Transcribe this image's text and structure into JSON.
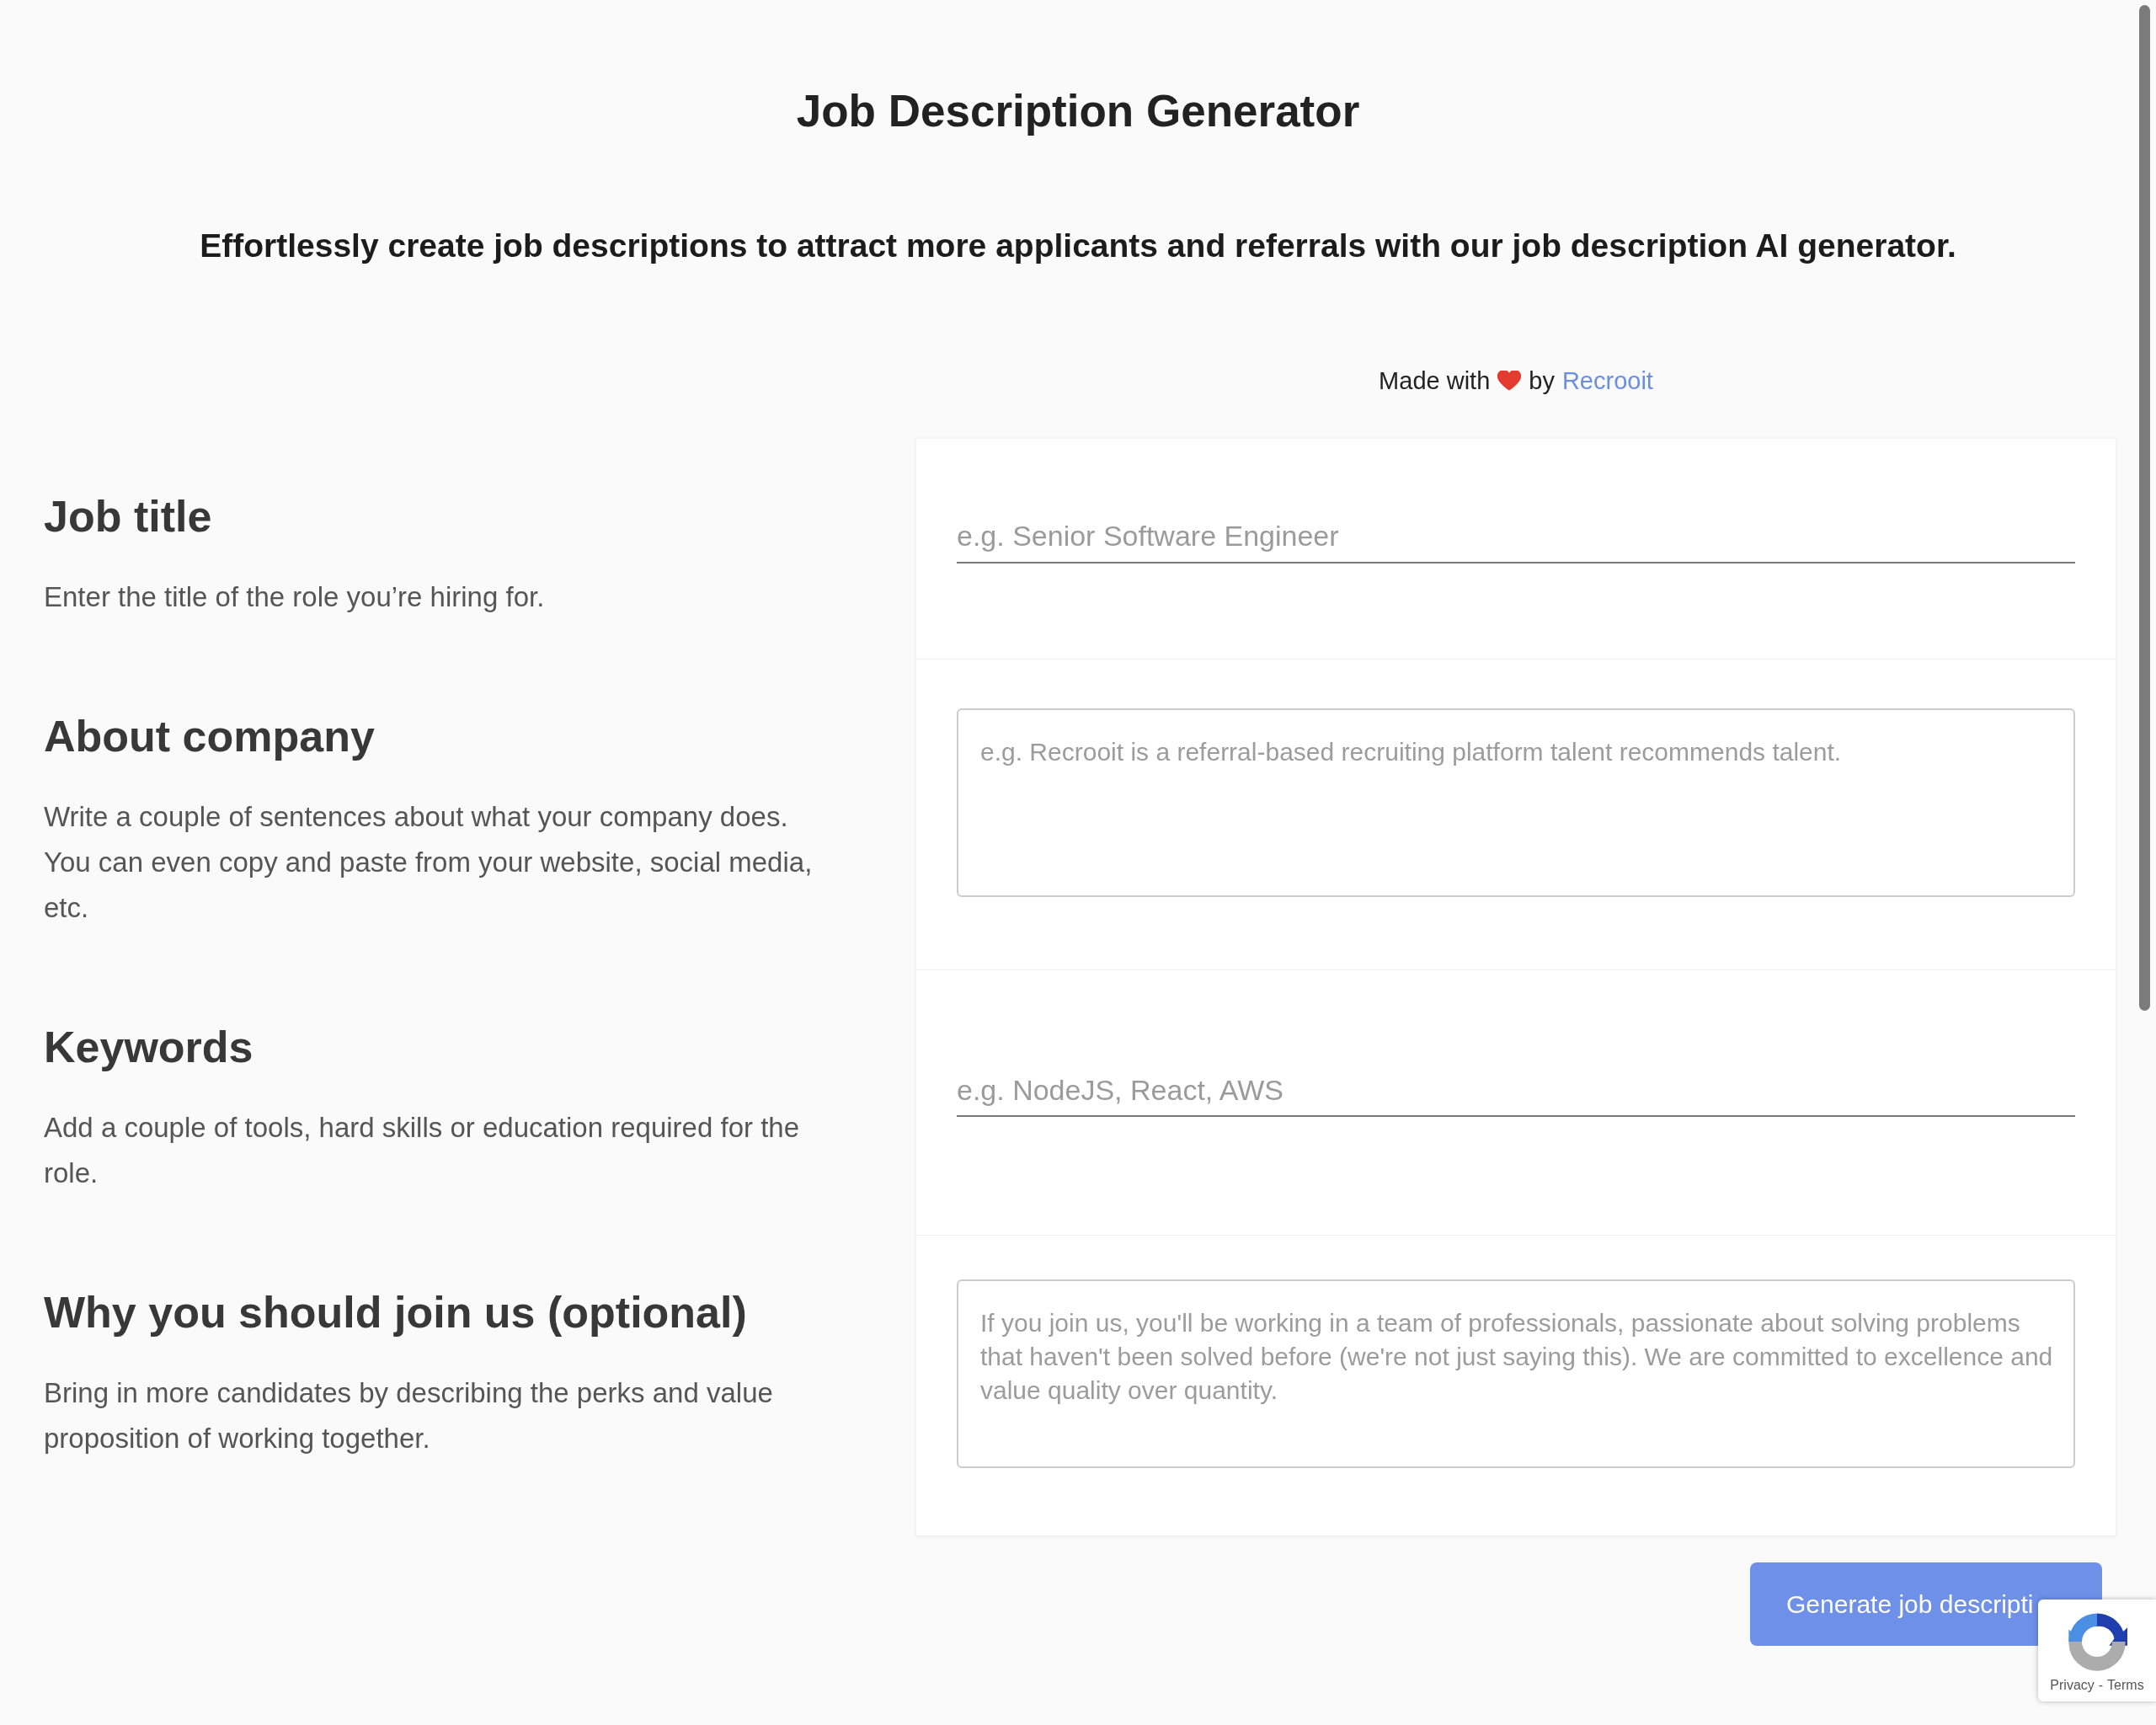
{
  "header": {
    "title": "Job Description Generator",
    "subtitle": "Effortlessly create job descriptions to attract more applicants and referrals with our job description AI generator."
  },
  "credit": {
    "prefix": "Made with",
    "middle": "by",
    "link": "Recrooit"
  },
  "sections": [
    {
      "heading": "Job title",
      "description": "Enter the title of the role you’re hiring for.",
      "field": {
        "kind": "line",
        "placeholder": "e.g. Senior Software Engineer"
      }
    },
    {
      "heading": "About company",
      "description": "Write a couple of sentences about what your company does. You can even copy and paste from your website, social media, etc.",
      "field": {
        "kind": "box",
        "placeholder": "e.g. Recrooit is a referral-based recruiting platform talent recommends talent."
      }
    },
    {
      "heading": "Keywords",
      "description": "Add a couple of tools, hard skills or education required for the role.",
      "field": {
        "kind": "line",
        "placeholder": "e.g. NodeJS, React, AWS"
      }
    },
    {
      "heading": "Why you should join us (optional)",
      "description": "Bring in more candidates by describing the perks and value proposition of working together.",
      "field": {
        "kind": "box",
        "placeholder": "If you join us, you'll be working in a team of professionals, passionate about solving problems that haven't been solved before (we're not just saying this). We are committed to excellence and value quality over quantity."
      }
    }
  ],
  "generate_button": {
    "label": "Generate job descripti"
  },
  "recaptcha_badge": {
    "links": [
      "Privacy",
      "Terms"
    ],
    "separator": "-"
  }
}
